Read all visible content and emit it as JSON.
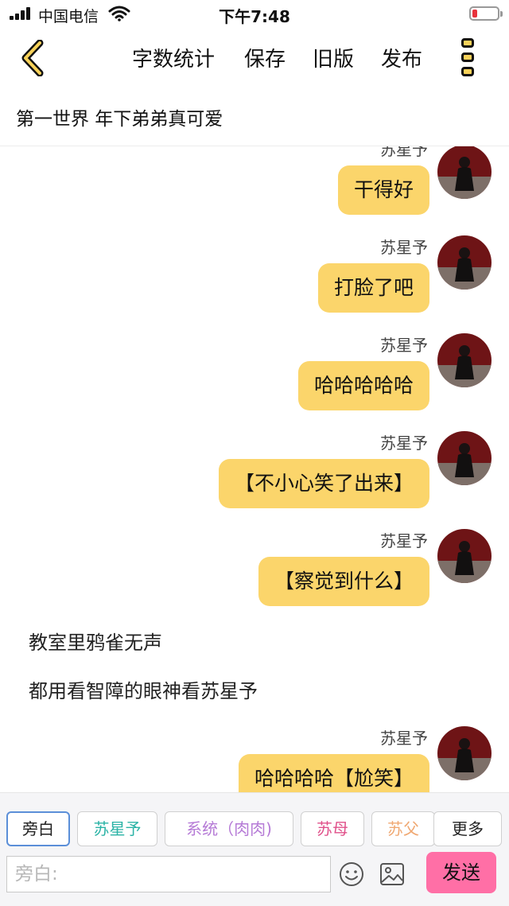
{
  "status_bar": {
    "carrier": "中国电信",
    "time": "下午7:48",
    "battery_color": "#e8323c"
  },
  "nav": {
    "back_icon": "chevron-left-icon",
    "items": [
      "字数统计",
      "保存",
      "旧版",
      "发布"
    ],
    "more_icon": "more-vertical-icon"
  },
  "chapter_title": "第一世界  年下弟弟真可爱",
  "chat": {
    "messages": [
      {
        "type": "character",
        "name": "苏星予",
        "text": "干得好"
      },
      {
        "type": "character",
        "name": "苏星予",
        "text": "打脸了吧"
      },
      {
        "type": "character",
        "name": "苏星予",
        "text": "哈哈哈哈哈"
      },
      {
        "type": "character",
        "name": "苏星予",
        "text": "【不小心笑了出来】"
      },
      {
        "type": "character",
        "name": "苏星予",
        "text": "【察觉到什么】"
      },
      {
        "type": "narration",
        "text": "教室里鸦雀无声"
      },
      {
        "type": "narration",
        "text": "都用看智障的眼神看苏星予"
      },
      {
        "type": "character",
        "name": "苏星予",
        "text": "哈哈哈哈【尬笑】"
      }
    ]
  },
  "roles": [
    {
      "label": "旁白",
      "color": "#222222",
      "active": true
    },
    {
      "label": "苏星予",
      "color": "#2bb3a6",
      "active": false
    },
    {
      "label": "系统（肉肉)",
      "color": "#b57ad6",
      "active": false
    },
    {
      "label": "苏母",
      "color": "#e0508a",
      "active": false
    },
    {
      "label": "苏父",
      "color": "#f0a872",
      "active": false
    },
    {
      "label": "更多",
      "color": "#222222",
      "active": false
    }
  ],
  "input": {
    "placeholder": "旁白:"
  },
  "toolbar": {
    "emoji_icon": "emoji-icon",
    "image_icon": "image-icon",
    "send_label": "发送"
  },
  "colors": {
    "bubble": "#fbd56b",
    "send": "#ff6fa6",
    "active_border": "#5b8fd8"
  }
}
